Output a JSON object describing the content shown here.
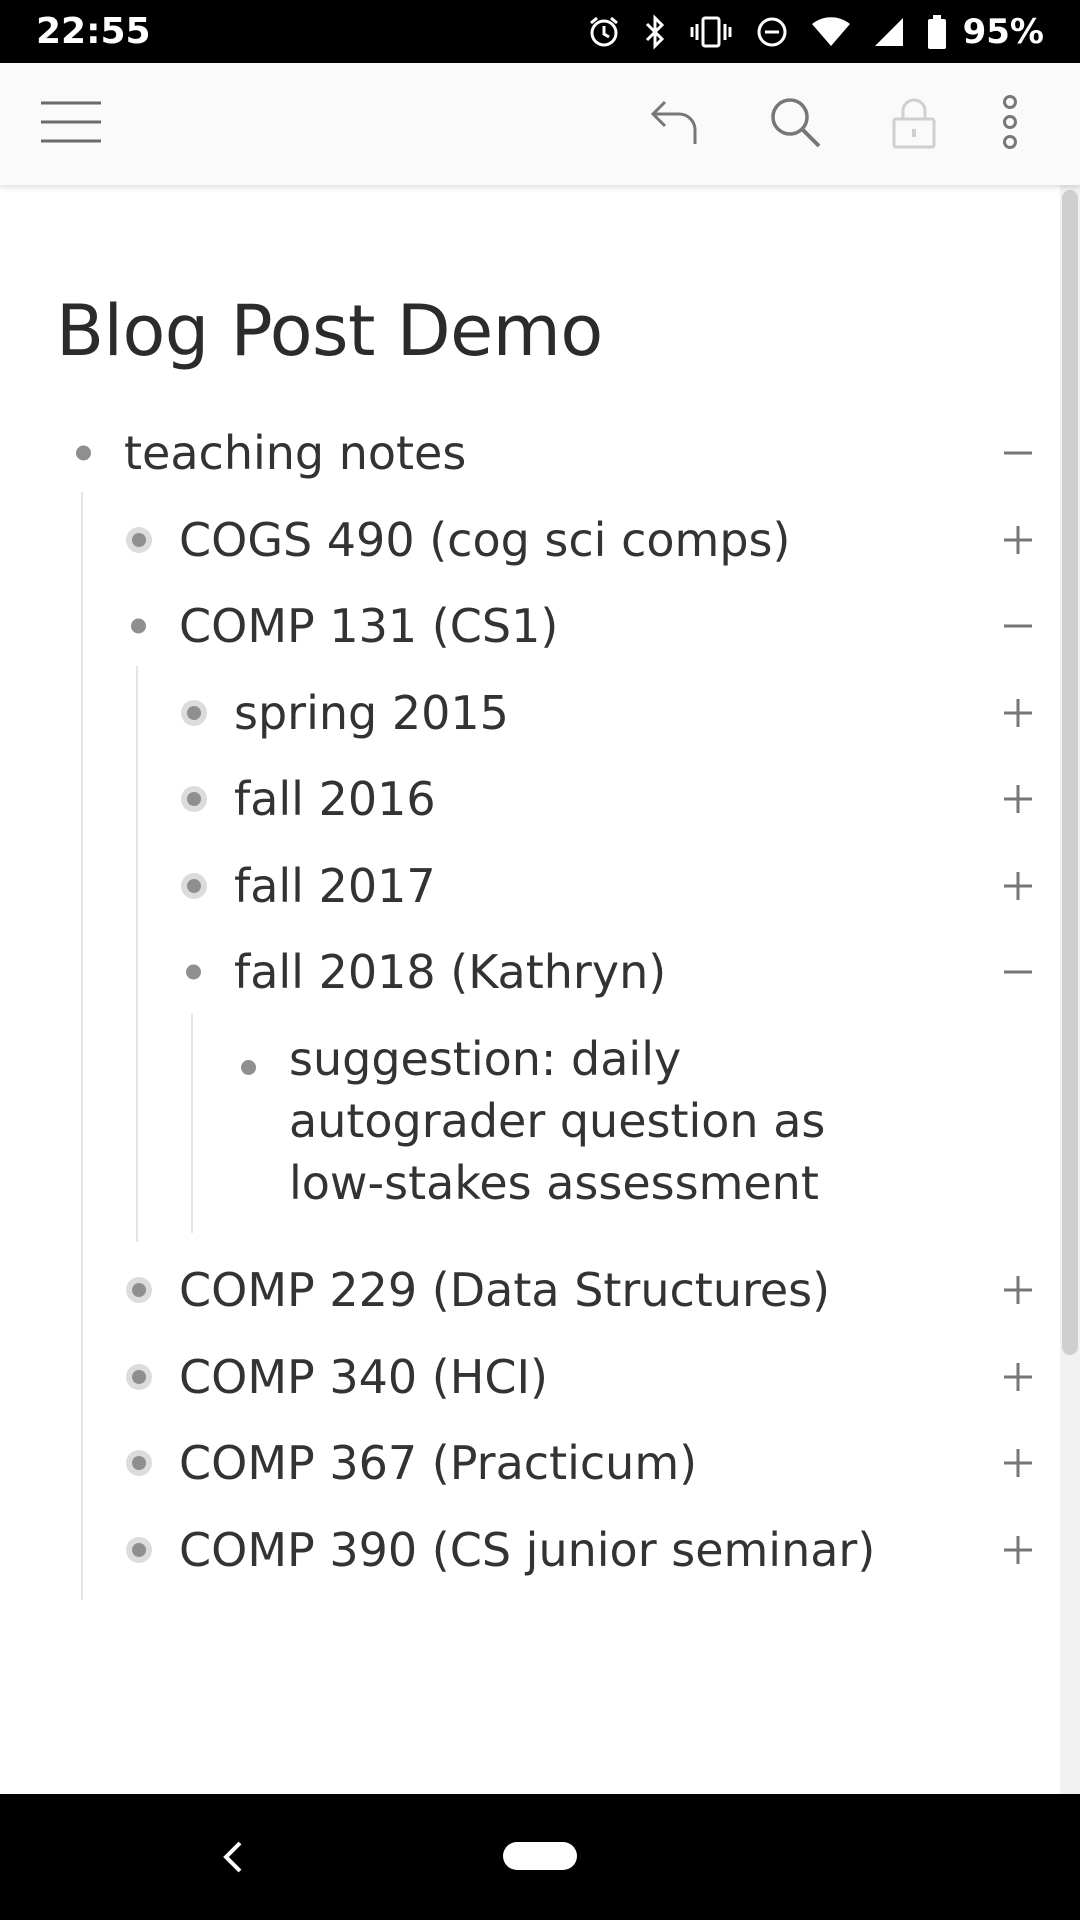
{
  "status": {
    "time": "22:55",
    "battery": "95%"
  },
  "doc": {
    "title": "Blog Post Demo"
  },
  "items": [
    {
      "label": "teaching notes",
      "toggle": "collapse"
    },
    {
      "label": "COGS 490 (cog sci comps)",
      "toggle": "expand"
    },
    {
      "label": "COMP 131 (CS1)",
      "toggle": "collapse"
    },
    {
      "label": "spring 2015",
      "toggle": "expand"
    },
    {
      "label": "fall 2016",
      "toggle": "expand"
    },
    {
      "label": "fall 2017",
      "toggle": "expand"
    },
    {
      "label": "fall 2018 (Kathryn)",
      "toggle": "collapse"
    },
    {
      "label": "suggestion: daily autograder question as low-stakes assessment"
    },
    {
      "label": "COMP 229 (Data Structures)",
      "toggle": "expand"
    },
    {
      "label": "COMP 340 (HCI)",
      "toggle": "expand"
    },
    {
      "label": "COMP 367 (Practicum)",
      "toggle": "expand"
    },
    {
      "label": "COMP 390 (CS junior seminar)",
      "toggle": "expand"
    }
  ],
  "icons": {
    "menu": "hamburger-icon",
    "undo": "undo-icon",
    "search": "search-icon",
    "lock": "lock-icon",
    "more": "more-vert-icon",
    "back": "back-icon",
    "home": "home-pill"
  }
}
